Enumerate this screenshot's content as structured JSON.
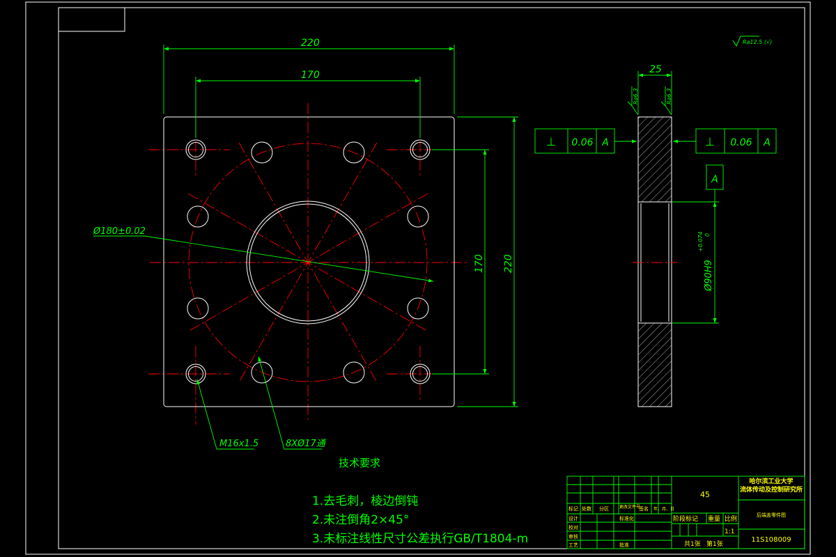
{
  "colors": {
    "background": "#000000",
    "frame": "#ffffff",
    "outline": "#ffffff",
    "centerline": "#ff0000",
    "dimension": "#00ff00",
    "title_text": "#ffff00"
  },
  "surface_finish": {
    "general": "Ra12.5 (√)",
    "left_face": "Ra6.3",
    "right_face": "Ra6.3"
  },
  "dimensions": {
    "plate_width": "220",
    "bolt_spacing_h": "170",
    "bolt_spacing_v": "170",
    "plate_height": "220",
    "thickness": "25",
    "pcd": "Ø180±0.02",
    "bore": "Ø90H9",
    "bore_tol": "+0.074",
    "bore_tol_low": "0",
    "thread": "M16x1.5",
    "holes": "8XØ17通"
  },
  "tolerance_frames": [
    {
      "symbol": "⊥",
      "value": "0.06",
      "datum": "A"
    },
    {
      "symbol": "⊥",
      "value": "0.06",
      "datum": "A"
    }
  ],
  "datum_label": "A",
  "tech_requirements": {
    "heading": "技术要求",
    "items": [
      "1.去毛刺，棱边倒钝",
      "2.未注倒角2×45°",
      "3.未标注线性尺寸公差执行GB/T1804-m"
    ]
  },
  "title_block": {
    "material": "45",
    "institution": "哈尔滨工业大学",
    "department": "流体传动及控制研究所",
    "part_name": "后端盖零件图",
    "drawing_number": "11S108009",
    "scale": "1:1",
    "sheets_total": "共1张",
    "sheet_no": "第1张",
    "stage_mark": "阶段标记",
    "weight": "重量",
    "scale_label": "比例",
    "labels": {
      "mark": "标记",
      "count": "处数",
      "zone": "分区",
      "change_doc": "更改文件号",
      "signature": "签名",
      "date": "年、月、日",
      "designer": "设计",
      "standardize": "标准化",
      "checker": "校对",
      "reviewer": "审核",
      "process": "工艺",
      "approve": "批准"
    }
  }
}
